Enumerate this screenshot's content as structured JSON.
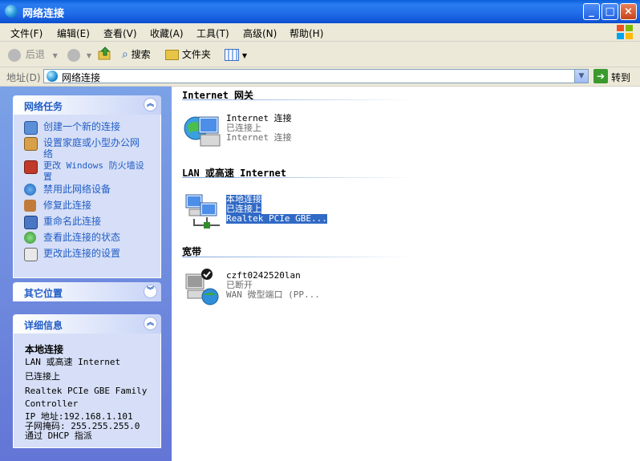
{
  "window": {
    "title": "网络连接",
    "minimize": "_",
    "maximize": "□",
    "close": "×"
  },
  "menu": [
    "文件(F)",
    "编辑(E)",
    "查看(V)",
    "收藏(A)",
    "工具(T)",
    "高级(N)",
    "帮助(H)"
  ],
  "toolbar": {
    "back": "后退",
    "search": "搜索",
    "folders": "文件夹"
  },
  "address": {
    "label": "地址(D)",
    "value": "网络连接",
    "go": "转到"
  },
  "left": {
    "tasks_title": "网络任务",
    "tasks": [
      "创建一个新的连接",
      "设置家庭或小型办公网络",
      "更改 Windows 防火墙设置",
      "禁用此网络设备",
      "修复此连接",
      "重命名此连接",
      "查看此连接的状态",
      "更改此连接的设置"
    ],
    "other_title": "其它位置",
    "details_title": "详细信息",
    "details": {
      "name": "本地连接",
      "type": "LAN 或高速 Internet",
      "status": "已连接上",
      "device": "Realtek PCIe GBE Family Controller",
      "ip": "IP 地址:192.168.1.101",
      "mask": "子网掩码: 255.255.255.0",
      "dhcp": "通过 DHCP 指派"
    }
  },
  "groups": [
    {
      "title": "Internet 网关",
      "items": [
        {
          "name": "Internet 连接",
          "status": "已连接上",
          "detail": "Internet 连接"
        }
      ]
    },
    {
      "title": "LAN 或高速 Internet",
      "items": [
        {
          "name": "本地连接",
          "status": "已连接上",
          "detail": "Realtek PCIe GBE..."
        }
      ]
    },
    {
      "title": "宽带",
      "items": [
        {
          "name": "czft0242520lan",
          "status": "已断开",
          "detail": "WAN 微型端口 (PP..."
        }
      ]
    }
  ]
}
